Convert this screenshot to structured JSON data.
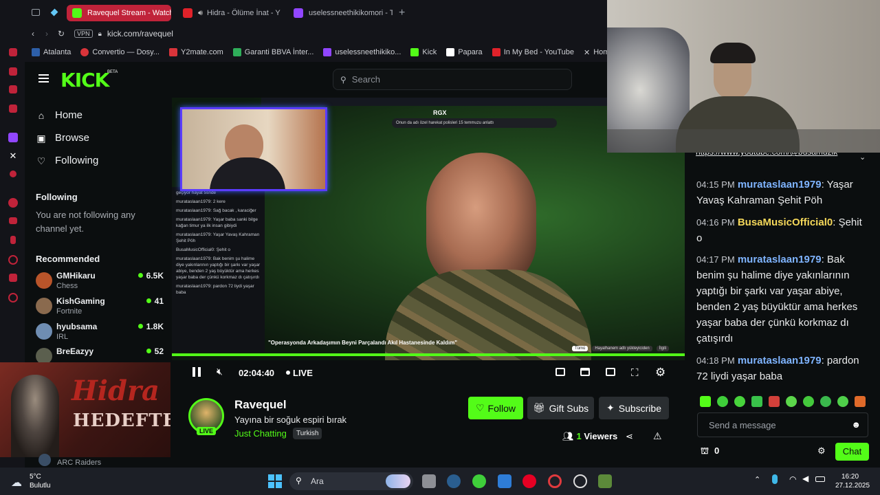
{
  "browser": {
    "tabs": [
      {
        "label": "Ravequel Stream - Watch",
        "active": true
      },
      {
        "label": "Hidra - Ölüme İnat - Y",
        "active": false
      },
      {
        "label": "uselessneethikikomori - T",
        "active": false
      }
    ],
    "address": {
      "vpn_label": "VPN",
      "url": "kick.com/ravequel"
    },
    "bookmarks": [
      "Atalanta",
      "Convertio — Dosy...",
      "Y2mate.com",
      "Garanti BBVA İnter...",
      "uselessneethikiko...",
      "Kick",
      "Papara",
      "In My Bed - YouTube",
      "Home"
    ]
  },
  "kick": {
    "logo": "KICK",
    "logo_badge": "BETA",
    "search_placeholder": "Search",
    "nav": {
      "home": "Home",
      "browse": "Browse",
      "following": "Following"
    },
    "following_section": {
      "title": "Following",
      "empty_text": "You are not following any channel yet."
    },
    "recommended": {
      "title": "Recommended",
      "items": [
        {
          "name": "GMHikaru",
          "category": "Chess",
          "viewers": "6.5K"
        },
        {
          "name": "KishGaming",
          "category": "Fortnite",
          "viewers": "41"
        },
        {
          "name": "hyubsama",
          "category": "IRL",
          "viewers": "1.8K"
        },
        {
          "name": "BreEazyy",
          "category": "",
          "viewers": "52"
        }
      ],
      "extra_category": "ARC Raiders"
    }
  },
  "video": {
    "overlay": {
      "rgx": "RGX",
      "search_text": "Onun da adı özel harekat polisleri 15 temmuzu anlattı",
      "caption": "\"Operasyonda Arkadaşımın Beyni Parçalandı Akıl Hastanesinde Kaldım\"",
      "chips": [
        "Tümü",
        "Hayalhanem adlı yükleyiciden",
        "İlgili"
      ],
      "mini_chat": [
        "geçiyor hayat 5snde",
        "murataslaan1979: 2 kere",
        "murataslaan1979: Sağ bacak , karaciğer",
        "murataslaan1979: Yaşar baba sanki bilge kağan timur ya ilk insan gibiydi",
        "murataslaan1979: Yaşar Yavaş Kahraman Şehit Pöh",
        "BusaMusicOfficial0: Şehit o",
        "murataslaan1979: Bak benim şu halime diye yakınlarının yaptığı bir şarkı var yaşar abiye, benden 2 yaş büyüktür ama herkes yaşar baba der çünkü korkmaz dı çatışırdı",
        "murataslaan1979: pardon 72 liydi yaşar baba"
      ]
    },
    "controls": {
      "time": "02:04:40",
      "live": "LIVE",
      "progress": 1.0
    }
  },
  "channel": {
    "name": "Ravequel",
    "title": "Yayına bir soğuk espiri bırak",
    "category": "Just Chatting",
    "tag": "Turkish",
    "live_badge": "LIVE",
    "buttons": {
      "follow": "Follow",
      "gift": "Gift Subs",
      "subscribe": "Subscribe"
    },
    "viewers": {
      "count": "1",
      "label": "Viewers"
    }
  },
  "chat": {
    "pinned_link": "https://www.youtube.com/@busamuzik",
    "messages": [
      {
        "time": "04:15 PM",
        "user": "murataslaan1979",
        "user_color": "#7fb4ff",
        "text": "Yaşar Yavaş Kahraman Şehit Pöh"
      },
      {
        "time": "04:16 PM",
        "user": "BusaMusicOfficial0",
        "user_color": "#f5d85a",
        "text": "Şehit o"
      },
      {
        "time": "04:17 PM",
        "user": "murataslaan1979",
        "user_color": "#7fb4ff",
        "text": "Bak benim şu halime diye yakınlarının yaptığı bir şarkı var yaşar abiye, benden 2 yaş büyüktür ama herkes yaşar baba der çünkü korkmaz dı çatışırdı"
      },
      {
        "time": "04:18 PM",
        "user": "murataslaan1979",
        "user_color": "#7fb4ff",
        "text": "pardon 72 liydi yaşar baba"
      }
    ],
    "input_placeholder": "Send a message",
    "points": "0",
    "send_label": "Chat"
  },
  "music_overlay": {
    "text": "HEDEFTE"
  },
  "taskbar": {
    "weather_temp": "5°C",
    "weather_desc": "Bulutlu",
    "search_label": "Ara",
    "time": "16:20",
    "date": "27.12.2025"
  },
  "colors": {
    "kick_green": "#53fc18",
    "tab_red": "#c0233a",
    "bg": "#0b0e0f"
  }
}
